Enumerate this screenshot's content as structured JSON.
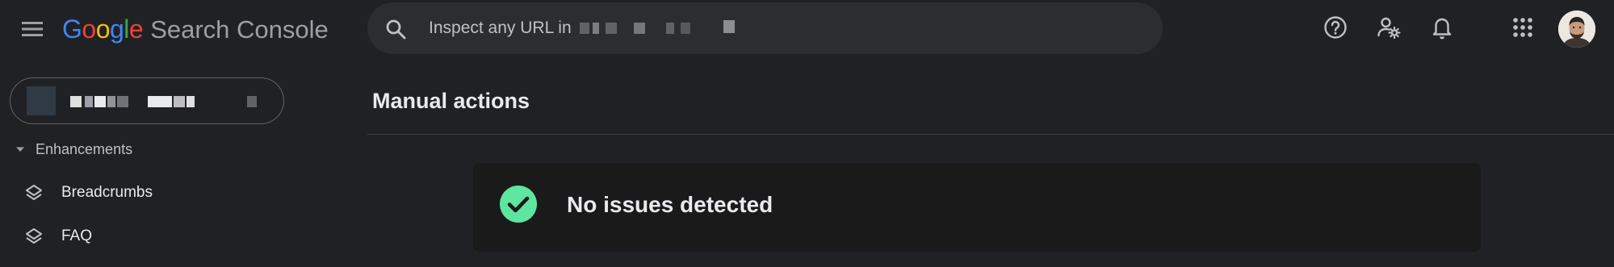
{
  "header": {
    "logo_google": [
      "G",
      "o",
      "o",
      "g",
      "l",
      "e"
    ],
    "logo_colors": [
      "#4285f4",
      "#ea4335",
      "#fbbc05",
      "#4285f4",
      "#34a853",
      "#ea4335"
    ],
    "product_name": "Search Console",
    "search_placeholder": "Inspect any URL in",
    "icons": [
      "menu-icon",
      "search-icon",
      "help-icon",
      "manage-users-icon",
      "notifications-icon",
      "apps-icon"
    ]
  },
  "sidebar": {
    "section_label": "Enhancements",
    "items": [
      {
        "label": "Breadcrumbs",
        "icon": "layers-icon"
      },
      {
        "label": "FAQ",
        "icon": "layers-icon"
      }
    ]
  },
  "main": {
    "title": "Manual actions",
    "status_text": "No issues detected",
    "status_color": "#5ee6a0"
  },
  "colors": {
    "background": "#202124",
    "card": "#1a1a1b",
    "text": "#e8eaed",
    "muted_text": "#bdc1c6"
  }
}
